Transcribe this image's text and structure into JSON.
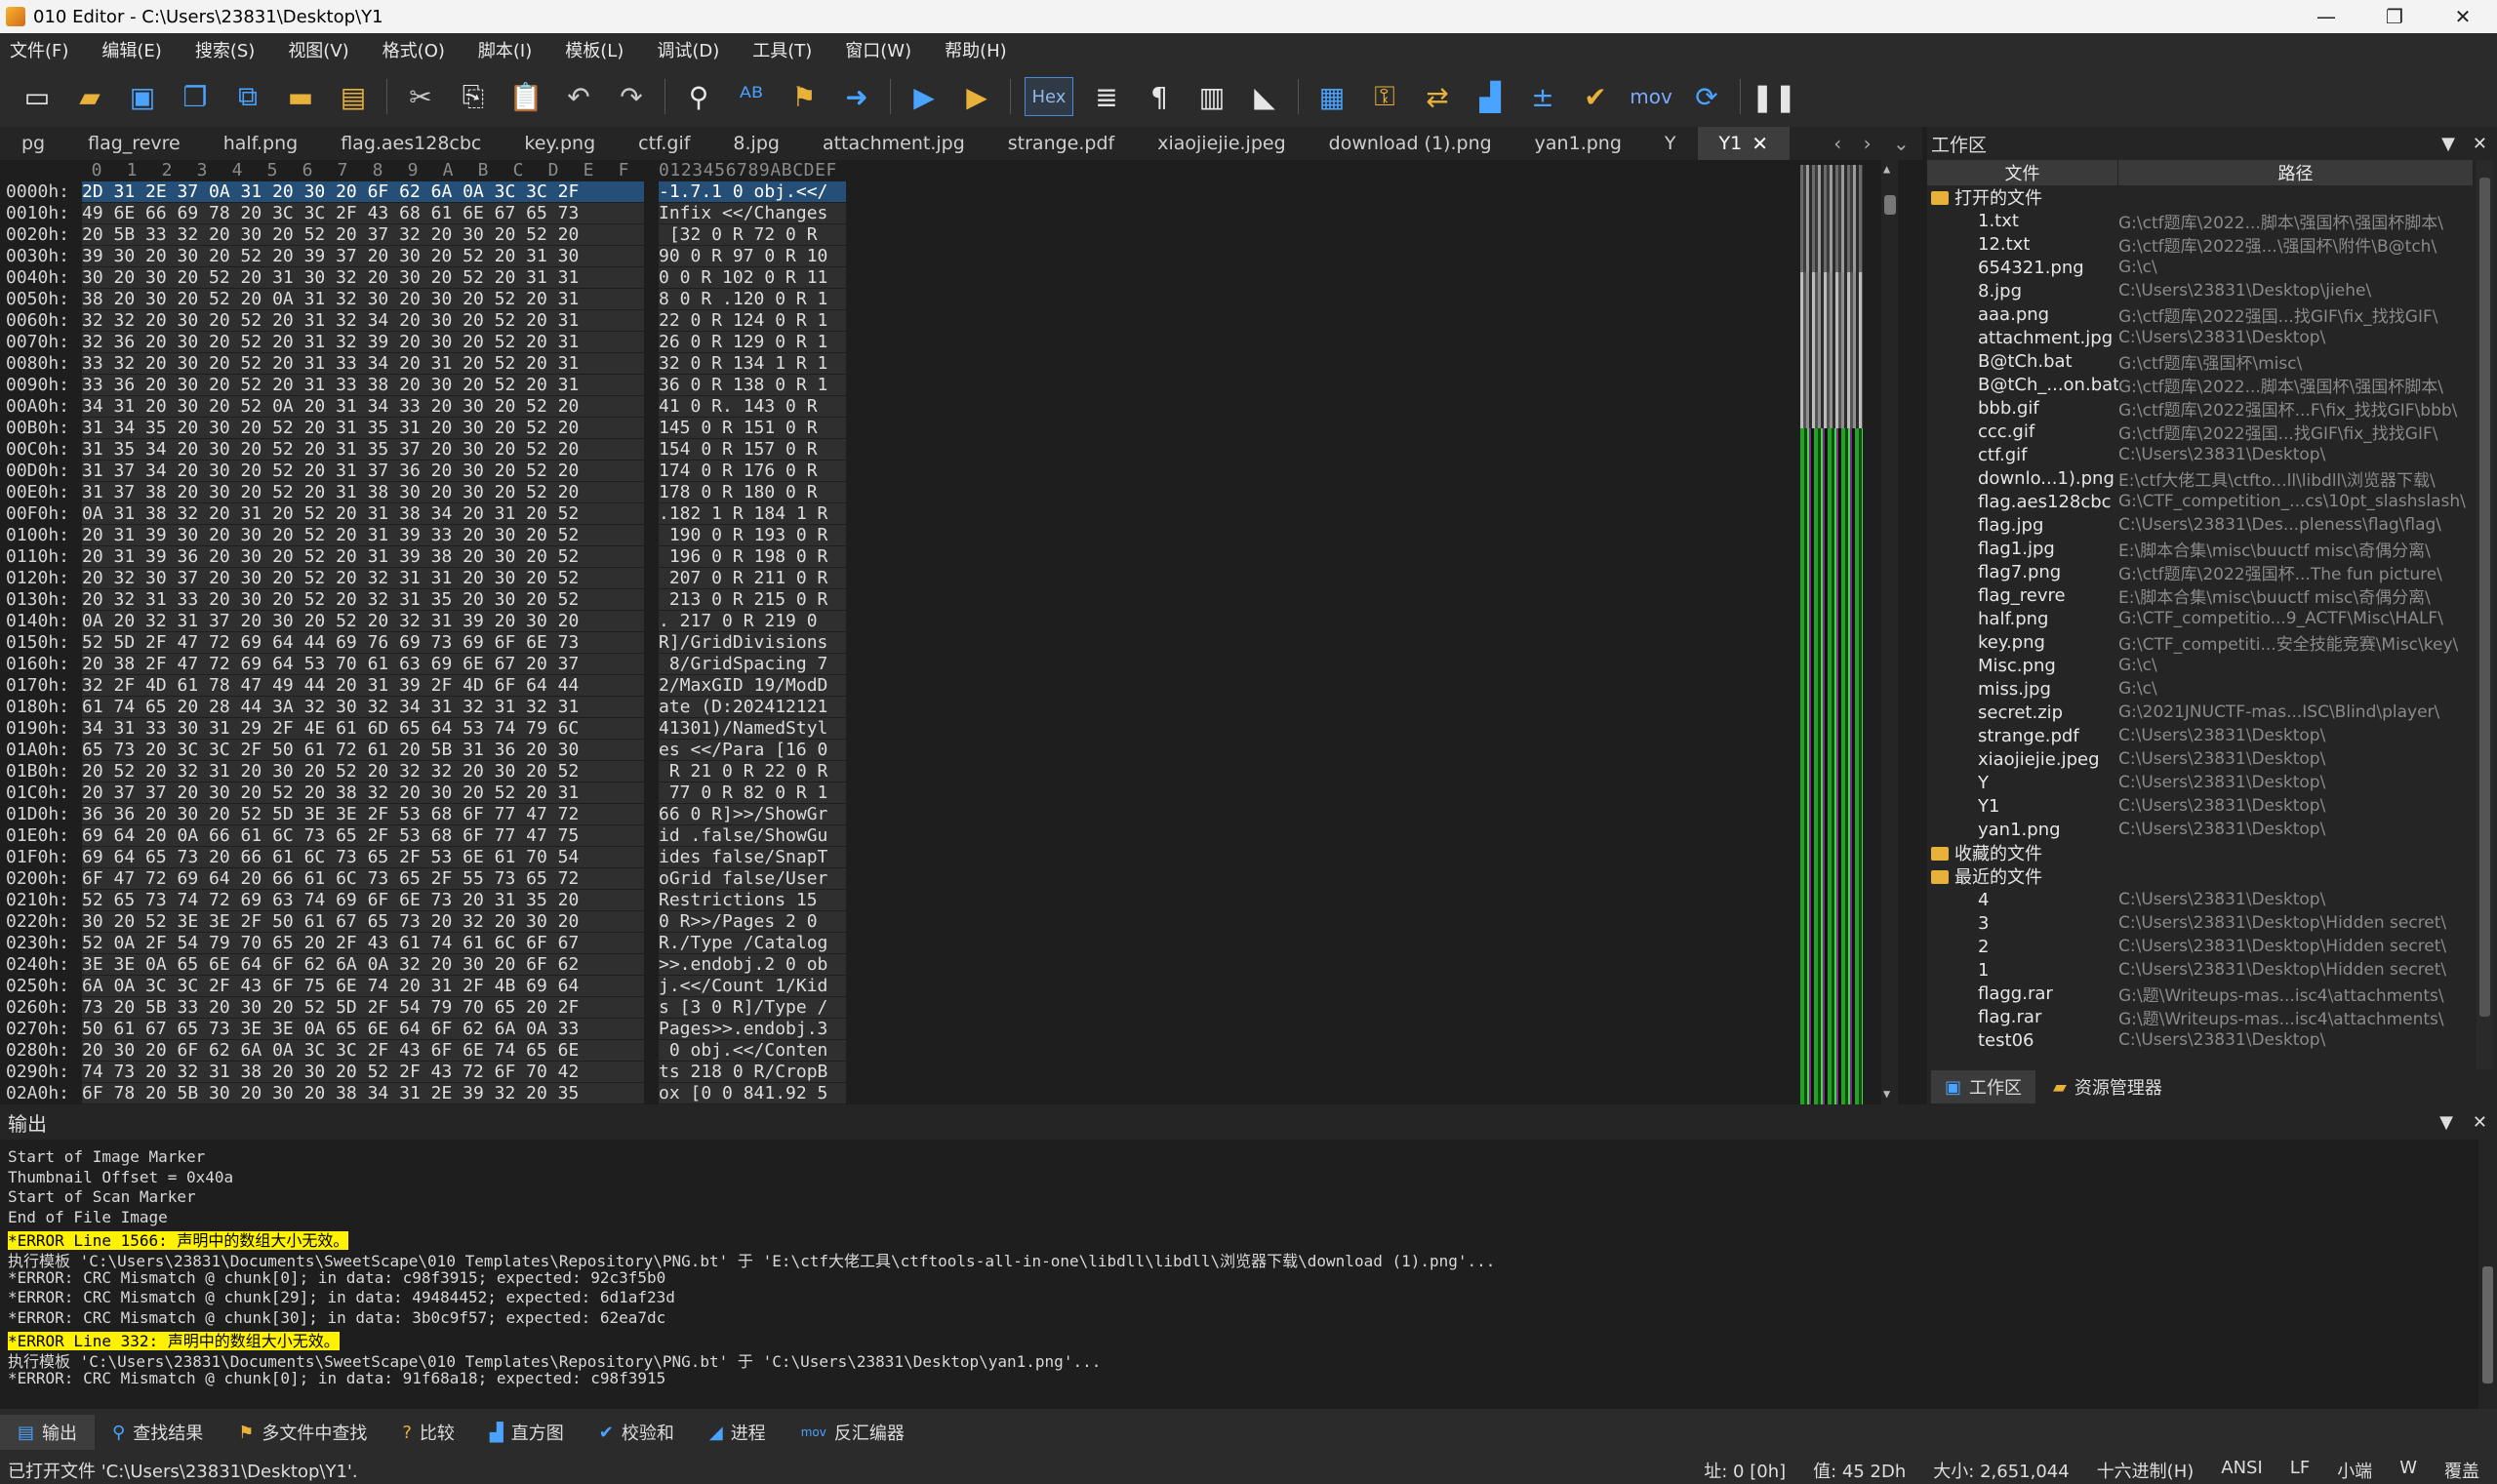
{
  "window": {
    "title": "010 Editor - C:\\Users\\23831\\Desktop\\Y1",
    "min": "—",
    "max": "❐",
    "close": "✕"
  },
  "menu": [
    "文件(F)",
    "编辑(E)",
    "搜索(S)",
    "视图(V)",
    "格式(O)",
    "脚本(I)",
    "模板(L)",
    "调试(D)",
    "工具(T)",
    "窗口(W)",
    "帮助(H)"
  ],
  "toolbar": {
    "hex_label": "Hex",
    "mov_label": "mov",
    "pilcrow": "¶"
  },
  "tabs": [
    "pg",
    "flag_revre",
    "half.png",
    "flag.aes128cbc",
    "key.png",
    "ctf.gif",
    "8.jpg",
    "attachment.jpg",
    "strange.pdf",
    "xiaojiejie.jpeg",
    "download (1).png",
    "yan1.png",
    "Y",
    "Y1"
  ],
  "active_tab": "Y1",
  "hex": {
    "col_headers": [
      "0",
      "1",
      "2",
      "3",
      "4",
      "5",
      "6",
      "7",
      "8",
      "9",
      "A",
      "B",
      "C",
      "D",
      "E",
      "F"
    ],
    "ascii_header": "0123456789ABCDEF",
    "rows": [
      {
        "addr": "0000h:",
        "hex": "2D 31 2E 37 0A 31 20 30 20 6F 62 6A 0A 3C 3C 2F",
        "ascii": "-1.7.1 0 obj.<</"
      },
      {
        "addr": "0010h:",
        "hex": "49 6E 66 69 78 20 3C 3C 2F 43 68 61 6E 67 65 73",
        "ascii": "Infix <</Changes"
      },
      {
        "addr": "0020h:",
        "hex": "20 5B 33 32 20 30 20 52 20 37 32 20 30 20 52 20",
        "ascii": " [32 0 R 72 0 R "
      },
      {
        "addr": "0030h:",
        "hex": "39 30 20 30 20 52 20 39 37 20 30 20 52 20 31 30",
        "ascii": "90 0 R 97 0 R 10"
      },
      {
        "addr": "0040h:",
        "hex": "30 20 30 20 52 20 31 30 32 20 30 20 52 20 31 31",
        "ascii": "0 0 R 102 0 R 11"
      },
      {
        "addr": "0050h:",
        "hex": "38 20 30 20 52 20 0A 31 32 30 20 30 20 52 20 31",
        "ascii": "8 0 R .120 0 R 1"
      },
      {
        "addr": "0060h:",
        "hex": "32 32 20 30 20 52 20 31 32 34 20 30 20 52 20 31",
        "ascii": "22 0 R 124 0 R 1"
      },
      {
        "addr": "0070h:",
        "hex": "32 36 20 30 20 52 20 31 32 39 20 30 20 52 20 31",
        "ascii": "26 0 R 129 0 R 1"
      },
      {
        "addr": "0080h:",
        "hex": "33 32 20 30 20 52 20 31 33 34 20 31 20 52 20 31",
        "ascii": "32 0 R 134 1 R 1"
      },
      {
        "addr": "0090h:",
        "hex": "33 36 20 30 20 52 20 31 33 38 20 30 20 52 20 31",
        "ascii": "36 0 R 138 0 R 1"
      },
      {
        "addr": "00A0h:",
        "hex": "34 31 20 30 20 52 0A 20 31 34 33 20 30 20 52 20",
        "ascii": "41 0 R. 143 0 R "
      },
      {
        "addr": "00B0h:",
        "hex": "31 34 35 20 30 20 52 20 31 35 31 20 30 20 52 20",
        "ascii": "145 0 R 151 0 R "
      },
      {
        "addr": "00C0h:",
        "hex": "31 35 34 20 30 20 52 20 31 35 37 20 30 20 52 20",
        "ascii": "154 0 R 157 0 R "
      },
      {
        "addr": "00D0h:",
        "hex": "31 37 34 20 30 20 52 20 31 37 36 20 30 20 52 20",
        "ascii": "174 0 R 176 0 R "
      },
      {
        "addr": "00E0h:",
        "hex": "31 37 38 20 30 20 52 20 31 38 30 20 30 20 52 20",
        "ascii": "178 0 R 180 0 R "
      },
      {
        "addr": "00F0h:",
        "hex": "0A 31 38 32 20 31 20 52 20 31 38 34 20 31 20 52",
        "ascii": ".182 1 R 184 1 R"
      },
      {
        "addr": "0100h:",
        "hex": "20 31 39 30 20 30 20 52 20 31 39 33 20 30 20 52",
        "ascii": " 190 0 R 193 0 R"
      },
      {
        "addr": "0110h:",
        "hex": "20 31 39 36 20 30 20 52 20 31 39 38 20 30 20 52",
        "ascii": " 196 0 R 198 0 R"
      },
      {
        "addr": "0120h:",
        "hex": "20 32 30 37 20 30 20 52 20 32 31 31 20 30 20 52",
        "ascii": " 207 0 R 211 0 R"
      },
      {
        "addr": "0130h:",
        "hex": "20 32 31 33 20 30 20 52 20 32 31 35 20 30 20 52",
        "ascii": " 213 0 R 215 0 R"
      },
      {
        "addr": "0140h:",
        "hex": "0A 20 32 31 37 20 30 20 52 20 32 31 39 20 30 20",
        "ascii": ". 217 0 R 219 0 "
      },
      {
        "addr": "0150h:",
        "hex": "52 5D 2F 47 72 69 64 44 69 76 69 73 69 6F 6E 73",
        "ascii": "R]/GridDivisions"
      },
      {
        "addr": "0160h:",
        "hex": "20 38 2F 47 72 69 64 53 70 61 63 69 6E 67 20 37",
        "ascii": " 8/GridSpacing 7"
      },
      {
        "addr": "0170h:",
        "hex": "32 2F 4D 61 78 47 49 44 20 31 39 2F 4D 6F 64 44",
        "ascii": "2/MaxGID 19/ModD"
      },
      {
        "addr": "0180h:",
        "hex": "61 74 65 20 28 44 3A 32 30 32 34 31 32 31 32 31",
        "ascii": "ate (D:202412121"
      },
      {
        "addr": "0190h:",
        "hex": "34 31 33 30 31 29 2F 4E 61 6D 65 64 53 74 79 6C",
        "ascii": "41301)/NamedStyl"
      },
      {
        "addr": "01A0h:",
        "hex": "65 73 20 3C 3C 2F 50 61 72 61 20 5B 31 36 20 30",
        "ascii": "es <</Para [16 0"
      },
      {
        "addr": "01B0h:",
        "hex": "20 52 20 32 31 20 30 20 52 20 32 32 20 30 20 52",
        "ascii": " R 21 0 R 22 0 R"
      },
      {
        "addr": "01C0h:",
        "hex": "20 37 37 20 30 20 52 20 38 32 20 30 20 52 20 31",
        "ascii": " 77 0 R 82 0 R 1"
      },
      {
        "addr": "01D0h:",
        "hex": "36 36 20 30 20 52 5D 3E 3E 2F 53 68 6F 77 47 72",
        "ascii": "66 0 R]>>/ShowGr"
      },
      {
        "addr": "01E0h:",
        "hex": "69 64 20 0A 66 61 6C 73 65 2F 53 68 6F 77 47 75",
        "ascii": "id .false/ShowGu"
      },
      {
        "addr": "01F0h:",
        "hex": "69 64 65 73 20 66 61 6C 73 65 2F 53 6E 61 70 54",
        "ascii": "ides false/SnapT"
      },
      {
        "addr": "0200h:",
        "hex": "6F 47 72 69 64 20 66 61 6C 73 65 2F 55 73 65 72",
        "ascii": "oGrid false/User"
      },
      {
        "addr": "0210h:",
        "hex": "52 65 73 74 72 69 63 74 69 6F 6E 73 20 31 35 20",
        "ascii": "Restrictions 15 "
      },
      {
        "addr": "0220h:",
        "hex": "30 20 52 3E 3E 2F 50 61 67 65 73 20 32 20 30 20",
        "ascii": "0 R>>/Pages 2 0 "
      },
      {
        "addr": "0230h:",
        "hex": "52 0A 2F 54 79 70 65 20 2F 43 61 74 61 6C 6F 67",
        "ascii": "R./Type /Catalog"
      },
      {
        "addr": "0240h:",
        "hex": "3E 3E 0A 65 6E 64 6F 62 6A 0A 32 20 30 20 6F 62",
        "ascii": ">>.endobj.2 0 ob"
      },
      {
        "addr": "0250h:",
        "hex": "6A 0A 3C 3C 2F 43 6F 75 6E 74 20 31 2F 4B 69 64",
        "ascii": "j.<</Count 1/Kid"
      },
      {
        "addr": "0260h:",
        "hex": "73 20 5B 33 20 30 20 52 5D 2F 54 79 70 65 20 2F",
        "ascii": "s [3 0 R]/Type /"
      },
      {
        "addr": "0270h:",
        "hex": "50 61 67 65 73 3E 3E 0A 65 6E 64 6F 62 6A 0A 33",
        "ascii": "Pages>>.endobj.3"
      },
      {
        "addr": "0280h:",
        "hex": "20 30 20 6F 62 6A 0A 3C 3C 2F 43 6F 6E 74 65 6E",
        "ascii": " 0 obj.<</Conten"
      },
      {
        "addr": "0290h:",
        "hex": "74 73 20 32 31 38 20 30 20 52 2F 43 72 6F 70 42",
        "ascii": "ts 218 0 R/CropB"
      },
      {
        "addr": "02A0h:",
        "hex": "6F 78 20 5B 30 20 30 20 38 34 31 2E 39 32 20 35",
        "ascii": "ox [0 0 841.92 5"
      }
    ]
  },
  "workspace": {
    "title": "工作区",
    "col_file": "文件",
    "col_path": "路径",
    "open_group": "打开的文件",
    "open_files": [
      {
        "name": "1.txt",
        "path": "G:\\ctf题库\\2022...脚本\\强国杯\\强国杯脚本\\"
      },
      {
        "name": "12.txt",
        "path": "G:\\ctf题库\\2022强...\\强国杯\\附件\\B@tch\\"
      },
      {
        "name": "654321.png",
        "path": "G:\\c\\"
      },
      {
        "name": "8.jpg",
        "path": "C:\\Users\\23831\\Desktop\\jiehe\\"
      },
      {
        "name": "aaa.png",
        "path": "G:\\ctf题库\\2022强国...找GIF\\fix_找找GIF\\"
      },
      {
        "name": "attachment.jpg",
        "path": "C:\\Users\\23831\\Desktop\\"
      },
      {
        "name": "B@tCh.bat",
        "path": "G:\\ctf题库\\强国杯\\misc\\"
      },
      {
        "name": "B@tCh_...on.bat",
        "path": "G:\\ctf题库\\2022...脚本\\强国杯\\强国杯脚本\\"
      },
      {
        "name": "bbb.gif",
        "path": "G:\\ctf题库\\2022强国杯...F\\fix_找找GIF\\bbb\\"
      },
      {
        "name": "ccc.gif",
        "path": "G:\\ctf题库\\2022强国...找GIF\\fix_找找GIF\\"
      },
      {
        "name": "ctf.gif",
        "path": "C:\\Users\\23831\\Desktop\\"
      },
      {
        "name": "downlo...1).png",
        "path": "E:\\ctf大佬工具\\ctfto...ll\\libdll\\浏览器下载\\"
      },
      {
        "name": "flag.aes128cbc",
        "path": "G:\\CTF_competition_...cs\\10pt_slashslash\\"
      },
      {
        "name": "flag.jpg",
        "path": "C:\\Users\\23831\\Des...pleness\\flag\\flag\\"
      },
      {
        "name": "flag1.jpg",
        "path": "E:\\脚本合集\\misc\\buuctf misc\\奇偶分离\\"
      },
      {
        "name": "flag7.png",
        "path": "G:\\ctf题库\\2022强国杯...The fun picture\\"
      },
      {
        "name": "flag_revre",
        "path": "E:\\脚本合集\\misc\\buuctf misc\\奇偶分离\\"
      },
      {
        "name": "half.png",
        "path": "G:\\CTF_competitio...9_ACTF\\Misc\\HALF\\"
      },
      {
        "name": "key.png",
        "path": "G:\\CTF_competiti...安全技能竞赛\\Misc\\key\\"
      },
      {
        "name": "Misc.png",
        "path": "G:\\c\\"
      },
      {
        "name": "miss.jpg",
        "path": "G:\\c\\"
      },
      {
        "name": "secret.zip",
        "path": "G:\\2021JNUCTF-mas...ISC\\Blind\\player\\"
      },
      {
        "name": "strange.pdf",
        "path": "C:\\Users\\23831\\Desktop\\"
      },
      {
        "name": "xiaojiejie.jpeg",
        "path": "C:\\Users\\23831\\Desktop\\"
      },
      {
        "name": "Y",
        "path": "C:\\Users\\23831\\Desktop\\"
      },
      {
        "name": "Y1",
        "path": "C:\\Users\\23831\\Desktop\\"
      },
      {
        "name": "yan1.png",
        "path": "C:\\Users\\23831\\Desktop\\"
      }
    ],
    "fav_group": "收藏的文件",
    "recent_group": "最近的文件",
    "recent_files": [
      {
        "name": "4",
        "path": "C:\\Users\\23831\\Desktop\\"
      },
      {
        "name": "3",
        "path": "C:\\Users\\23831\\Desktop\\Hidden secret\\"
      },
      {
        "name": "2",
        "path": "C:\\Users\\23831\\Desktop\\Hidden secret\\"
      },
      {
        "name": "1",
        "path": "C:\\Users\\23831\\Desktop\\Hidden secret\\"
      },
      {
        "name": "flagg.rar",
        "path": "G:\\题\\Writeups-mas...isc4\\attachments\\"
      },
      {
        "name": "flag.rar",
        "path": "G:\\题\\Writeups-mas...isc4\\attachments\\"
      },
      {
        "name": "test06",
        "path": "C:\\Users\\23831\\Desktop\\"
      }
    ],
    "tab_workspace": "工作区",
    "tab_explorer": "资源管理器"
  },
  "output": {
    "title": "输出",
    "lines": [
      {
        "text": "Start of Image Marker",
        "err": false
      },
      {
        "text": "Thumbnail Offset = 0x40a",
        "err": false
      },
      {
        "text": "Start of Scan Marker",
        "err": false
      },
      {
        "text": "End of File Image",
        "err": false
      },
      {
        "text": "*ERROR Line 1566: 声明中的数组大小无效。",
        "err": true
      },
      {
        "text": "执行模板 'C:\\Users\\23831\\Documents\\SweetScape\\010 Templates\\Repository\\PNG.bt' 于 'E:\\ctf大佬工具\\ctftools-all-in-one\\libdll\\libdll\\浏览器下载\\download (1).png'...",
        "err": false
      },
      {
        "text": "*ERROR: CRC Mismatch @ chunk[0]; in data: c98f3915; expected: 92c3f5b0",
        "err": false
      },
      {
        "text": "*ERROR: CRC Mismatch @ chunk[29]; in data: 49484452; expected: 6d1af23d",
        "err": false
      },
      {
        "text": "*ERROR: CRC Mismatch @ chunk[30]; in data: 3b0c9f57; expected: 62ea7dc",
        "err": false
      },
      {
        "text": "*ERROR Line 332: 声明中的数组大小无效。",
        "err": true
      },
      {
        "text": "执行模板 'C:\\Users\\23831\\Documents\\SweetScape\\010 Templates\\Repository\\PNG.bt' 于 'C:\\Users\\23831\\Desktop\\yan1.png'...",
        "err": false
      },
      {
        "text": "*ERROR: CRC Mismatch @ chunk[0]; in data: 91f68a18; expected: c98f3915",
        "err": false
      }
    ]
  },
  "bottom_tabs": [
    "输出",
    "查找结果",
    "多文件中查找",
    "比较",
    "直方图",
    "校验和",
    "进程",
    "反汇编器"
  ],
  "status": {
    "left": "已打开文件 'C:\\Users\\23831\\Desktop\\Y1'.",
    "addr": "址: 0 [0h]",
    "value": "值: 45 2Dh",
    "size": "大小: 2,651,044",
    "mode": "十六进制(H)",
    "encoding": "ANSI",
    "eol": "LF",
    "endian": "小端",
    "w": "W",
    "overwrite": "覆盖"
  }
}
